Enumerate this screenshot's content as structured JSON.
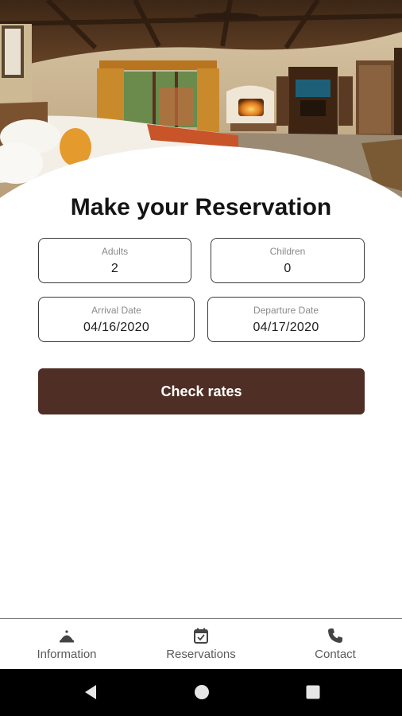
{
  "page": {
    "title": "Make your Reservation"
  },
  "form": {
    "adults": {
      "label": "Adults",
      "value": "2"
    },
    "children": {
      "label": "Children",
      "value": "0"
    },
    "arrival": {
      "label": "Arrival Date",
      "value": "04/16/2020"
    },
    "departure": {
      "label": "Departure Date",
      "value": "04/17/2020"
    },
    "submit_label": "Check rates"
  },
  "bottom_nav": {
    "items": [
      {
        "label": "Information",
        "icon": "hotel-bell-icon"
      },
      {
        "label": "Reservations",
        "icon": "calendar-check-icon"
      },
      {
        "label": "Contact",
        "icon": "phone-icon"
      }
    ]
  },
  "system_nav": {
    "icons": [
      "back-icon",
      "home-icon",
      "recents-icon"
    ]
  },
  "colors": {
    "accent": "#4f2e25",
    "border": "#3a3a3a",
    "background": "#ffffff"
  }
}
